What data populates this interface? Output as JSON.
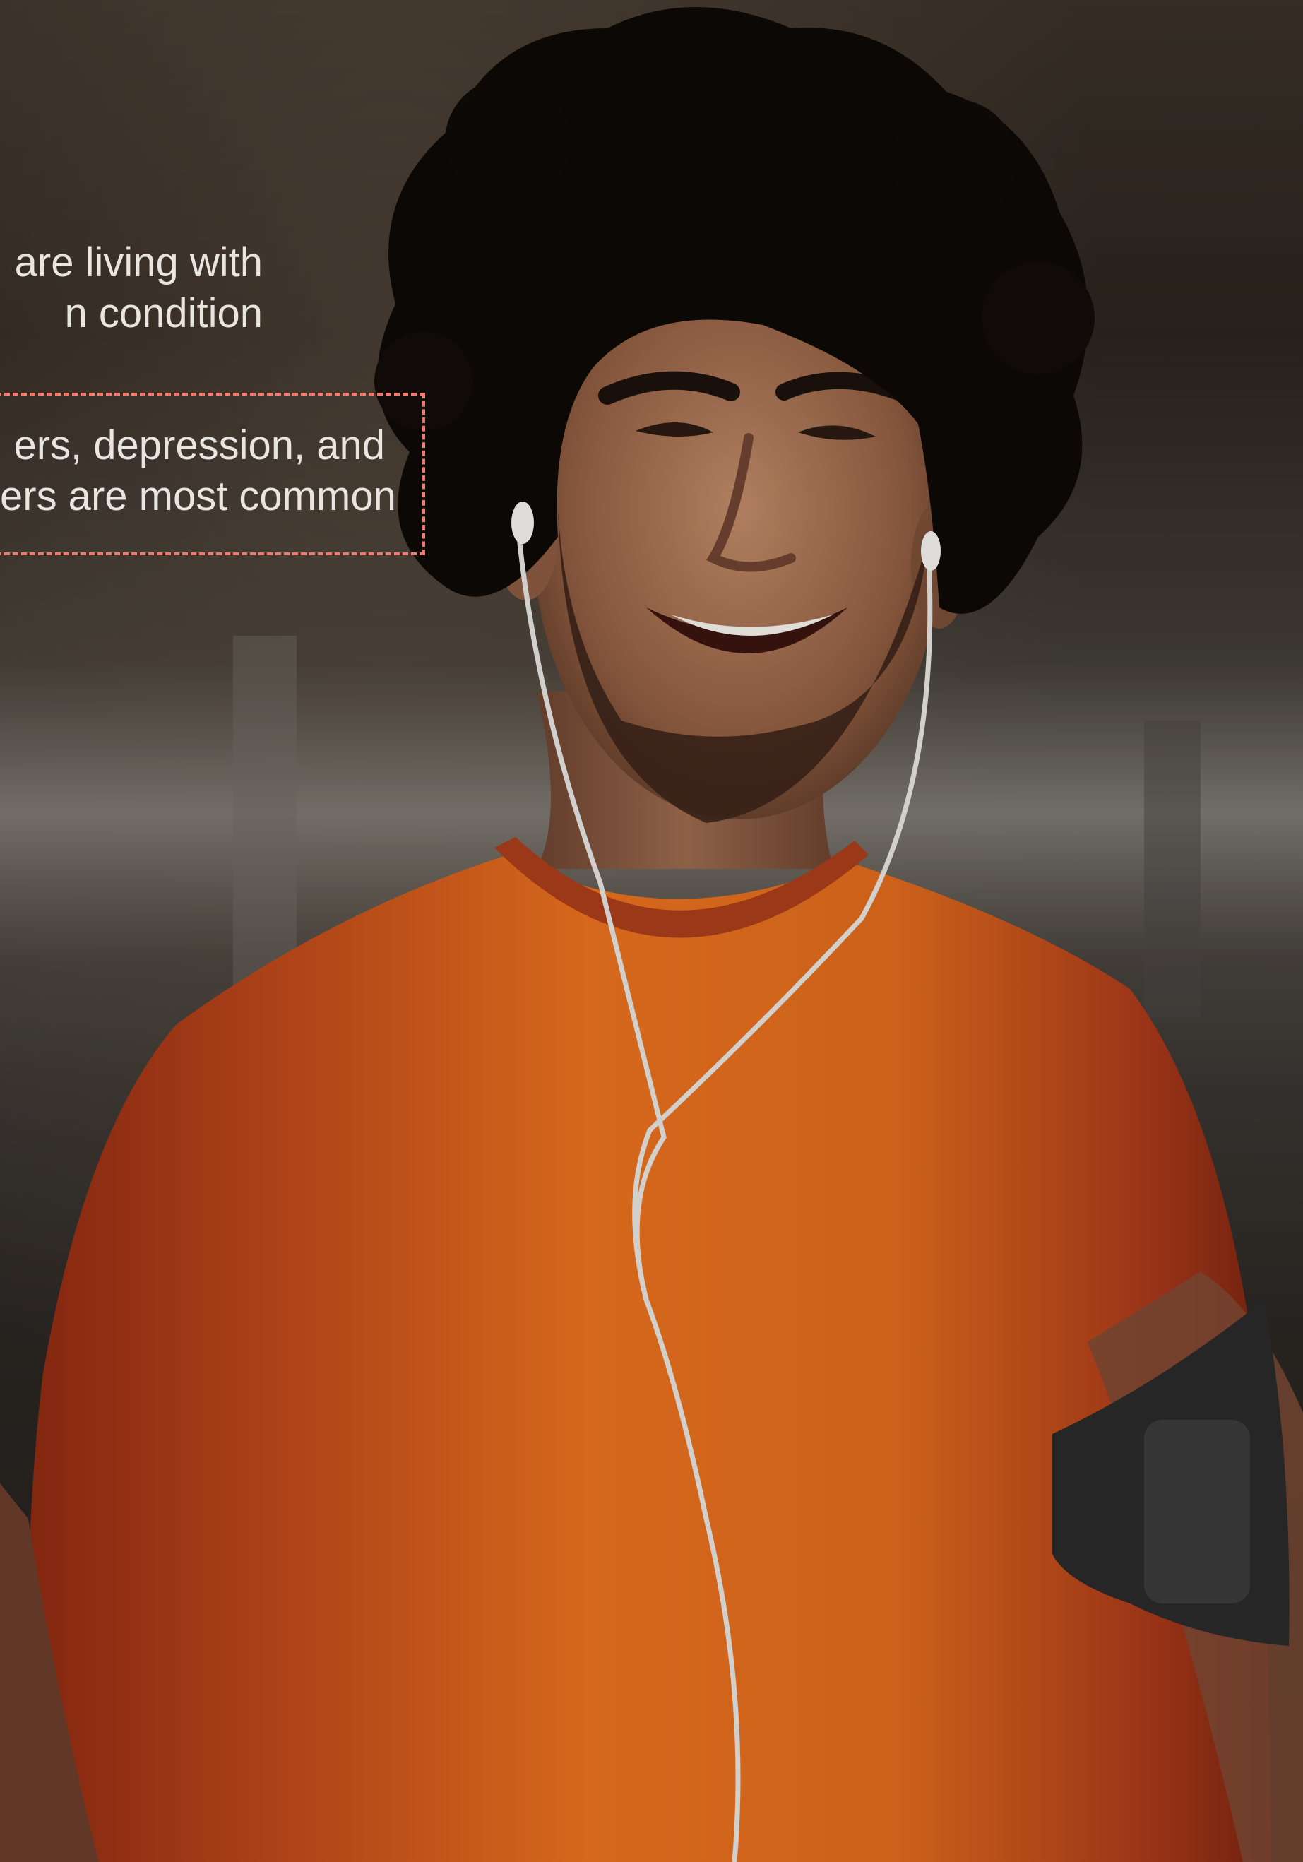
{
  "stat_1": {
    "line_1": "are living with",
    "line_2": "n condition"
  },
  "stat_2": {
    "line_1": "ers, depression, and",
    "line_2": "ers are most common"
  },
  "colors": {
    "text": "#e9e6e2",
    "callout_border": "#f07a6c",
    "shirt": "#e0661c",
    "shirt_dark": "#9b2f14",
    "hair": "#0e0a08",
    "skin": "#b47e5e"
  }
}
